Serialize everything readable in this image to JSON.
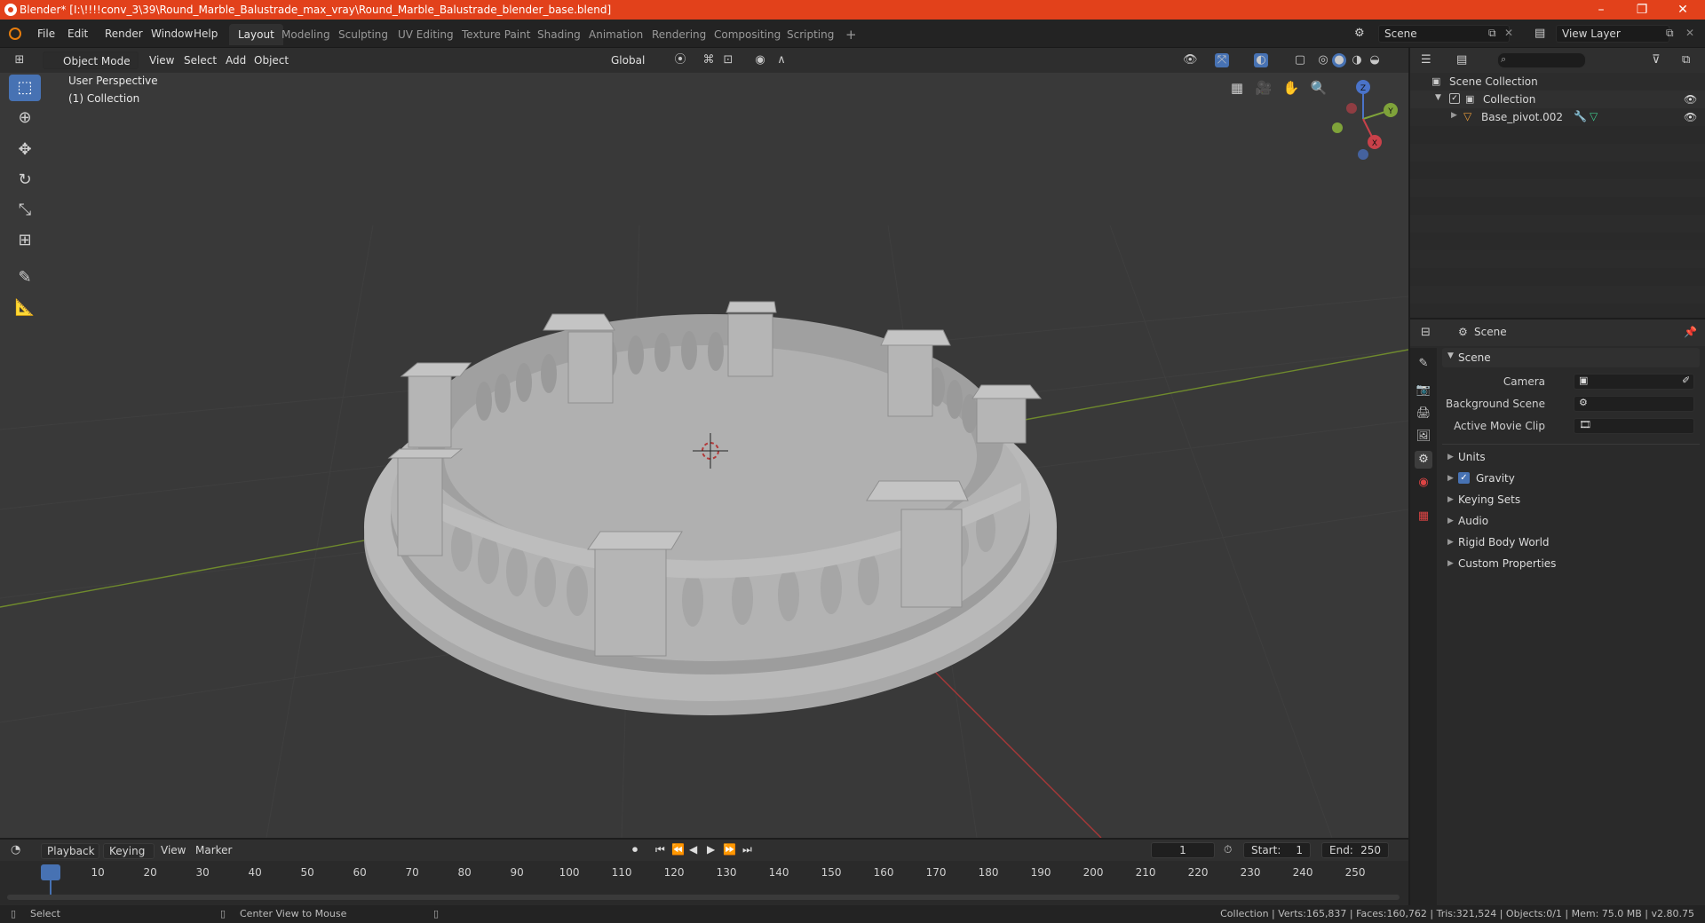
{
  "window": {
    "title": "Blender* [I:\\!!!!conv_3\\39\\Round_Marble_Balustrade_max_vray\\Round_Marble_Balustrade_blender_base.blend]",
    "minimize": "–",
    "maximize": "❐",
    "close": "✕"
  },
  "menu": {
    "file": "File",
    "edit": "Edit",
    "render": "Render",
    "window": "Window",
    "help": "Help"
  },
  "workspaces": [
    "Layout",
    "Modeling",
    "Sculpting",
    "UV Editing",
    "Texture Paint",
    "Shading",
    "Animation",
    "Rendering",
    "Compositing",
    "Scripting"
  ],
  "add_workspace": "+",
  "scene_field": "Scene",
  "view_layer_field": "View Layer",
  "viewport": {
    "mode": "Object Mode",
    "view": "View",
    "select": "Select",
    "add": "Add",
    "object": "Object",
    "orientation": "Global",
    "perspective_label": "User Perspective",
    "collection_label": "(1) Collection",
    "gizmo": {
      "x": "X",
      "y": "Y",
      "z": "Z"
    }
  },
  "outliner": {
    "search_placeholder": "",
    "scene_collection": "Scene Collection",
    "collection": "Collection",
    "object": "Base_pivot.002"
  },
  "properties": {
    "header": "Scene",
    "panel_title": "Scene",
    "camera_label": "Camera",
    "background_scene_label": "Background Scene",
    "active_movie_clip_label": "Active Movie Clip",
    "sections": [
      "Units",
      "Gravity",
      "Keying Sets",
      "Audio",
      "Rigid Body World",
      "Custom Properties"
    ],
    "gravity_checked": true
  },
  "timeline": {
    "playback": "Playback",
    "keying": "Keying",
    "view": "View",
    "marker": "Marker",
    "current_frame": "1",
    "start_label": "Start:",
    "start_value": "1",
    "end_label": "End:",
    "end_value": "250",
    "ticks": [
      "1",
      "10",
      "20",
      "30",
      "40",
      "50",
      "60",
      "70",
      "80",
      "90",
      "100",
      "110",
      "120",
      "130",
      "140",
      "150",
      "160",
      "170",
      "180",
      "190",
      "200",
      "210",
      "220",
      "230",
      "240",
      "250"
    ]
  },
  "status": {
    "select": "Select",
    "center_view": "Center View to Mouse",
    "stats": "Collection | Verts:165,837 | Faces:160,762 | Tris:321,524 | Objects:0/1 | Mem: 75.0 MB | v2.80.75"
  },
  "colors": {
    "title_bar": "#e2411b",
    "accent": "#4772b3",
    "viewport_bg": "#393939",
    "axis_x": "#b33a3a",
    "axis_y": "#7a9a2e"
  }
}
